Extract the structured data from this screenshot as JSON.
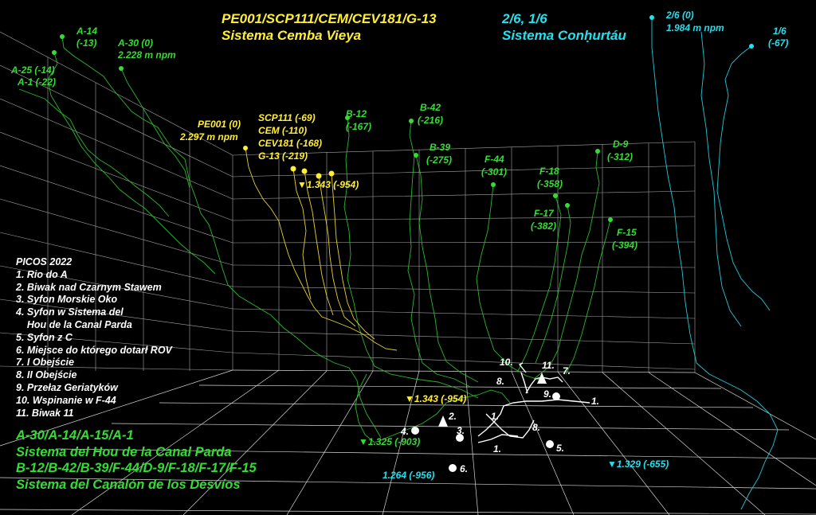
{
  "titles": {
    "cemba_ids": "PE001/SCP111/CEM/CEV181/G-13",
    "cemba_name": "Sistema Cemba Vieya",
    "conhurtau_ids": "2/6, 1/6",
    "conhurtau_name": "Sistema Conḥurtáu"
  },
  "entrances": {
    "a14": "A-14",
    "a14_depth": "(-13)",
    "a30": "A-30 (0)",
    "a30_alt": "2.228 m npm",
    "a25": "A-25 (-14)",
    "a1": "A-1 (-22)",
    "pe001": "PE001 (0)",
    "pe001_alt": "2.297 m npm",
    "scp111": "SCP111 (-69)",
    "cem": "CEM (-110)",
    "cev181": "CEV181 (-168)",
    "g13": "G-13 (-219)",
    "b12": "B-12",
    "b12_depth": "(-167)",
    "b42": "B-42",
    "b42_depth": "(-216)",
    "b39": "B-39",
    "b39_depth": "(-275)",
    "f44": "F-44",
    "f44_depth": "(-301)",
    "d9": "D-9",
    "d9_depth": "(-312)",
    "f18": "F-18",
    "f18_depth": "(-358)",
    "f17": "F-17",
    "f17_depth": "(-382)",
    "f15": "F-15",
    "f15_depth": "(-394)",
    "e26": "2/6 (0)",
    "e26_alt": "1.984 m npm",
    "e16": "1/6",
    "e16_depth": "(-67)"
  },
  "depths": {
    "d1343_top": "▼1.343 (-954)",
    "d1343_bottom": "▼1.343 (-954)",
    "d1325": "▼1.325 (-903)",
    "d1264": "1.264 (-956)",
    "d1329": "▼1.329 (-655)"
  },
  "points": {
    "p1a": "1.",
    "p1b": "1.",
    "p1c": "1.",
    "p2": "2.",
    "p3": "3.",
    "p4": "4.",
    "p5": "5.",
    "p6": "6.",
    "p7": "7.",
    "p8a": "8.",
    "p8b": "8.",
    "p9": "9.",
    "p10": "10.",
    "p11": "11."
  },
  "legend": {
    "title": "PICOS 2022",
    "items": [
      "1. Rio do A",
      "2. Biwak nad Czarnym Stawem",
      "3. Syfon Morskie Oko",
      "4. Syfon w Sistema del",
      "    Hou de la Canal Parda",
      "5. Syfon z C",
      "6. Miejsce do którego dotarł ROV",
      "7. I Obejście",
      "8. II Obejście",
      "9. Przełaz Geriatyków",
      "10. Wspinanie w F-44",
      "11. Biwak 11"
    ]
  },
  "systems": [
    "A-30/A-14/A-15/A-1",
    "Sistema del Hou de la Canal Parda",
    "B-12/B-42/B-39/F-44/D-9/F-18/F-17/F-15",
    "Sistema del Canalón de los Desvíos"
  ],
  "colors": {
    "green": "#33dd33",
    "yellow": "#ffee33",
    "cyan": "#22e0ee",
    "white": "#ffffff",
    "grid": "#d8d8d8"
  }
}
